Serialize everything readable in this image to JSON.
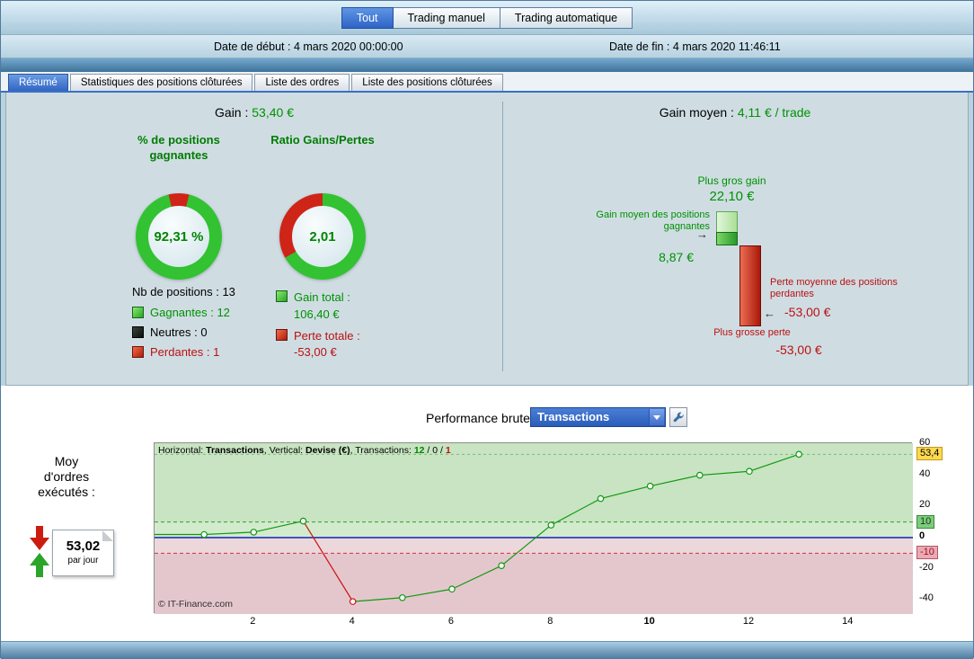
{
  "colors": {
    "accent_blue": "#3366cc",
    "positive_green": "#009100",
    "negative_red": "#bb1111",
    "chart_line_green": "#119911",
    "chart_line_red": "#cc1111",
    "zero_line_blue": "#2233bb",
    "current_value_bg": "#ffd94f"
  },
  "top_tabs": [
    {
      "label": "Tout",
      "selected": true
    },
    {
      "label": "Trading manuel",
      "selected": false
    },
    {
      "label": "Trading automatique",
      "selected": false
    }
  ],
  "date_bar": {
    "start_label": "Date de début :",
    "start_value": "4 mars 2020 00:00:00",
    "end_label": "Date de fin :",
    "end_value": "4 mars 2020 11:46:11"
  },
  "section_tabs": [
    {
      "label": "Résumé",
      "selected": true
    },
    {
      "label": "Statistiques des positions clôturées",
      "selected": false
    },
    {
      "label": "Liste des ordres",
      "selected": false
    },
    {
      "label": "Liste des positions clôturées",
      "selected": false
    }
  ],
  "summary": {
    "gain_label": "Gain : ",
    "gain_value": "53,40 €",
    "gain_moyen_label": "Gain moyen : ",
    "gain_moyen_value": "4,11 € / trade",
    "win_donut": {
      "title": "% de positions gagnantes",
      "value": "92,31 %",
      "red_pct": 7.69
    },
    "ratio_donut": {
      "title": "Ratio Gains/Pertes",
      "value": "2,01",
      "red_pct": 33.2
    },
    "nb_positions": "Nb de positions : 13",
    "legend": [
      {
        "label": "Gagnantes : 12",
        "color": "green"
      },
      {
        "label": "Neutres : 0",
        "color": "black"
      },
      {
        "label": "Perdantes : 1",
        "color": "red"
      }
    ],
    "gain_total_label": "Gain total :",
    "gain_total_value": "106,40 €",
    "perte_totale_label": "Perte totale :",
    "perte_totale_value": "-53,00 €",
    "plus_gros_gain_label": "Plus gros gain",
    "plus_gros_gain_value": "22,10 €",
    "gain_moyen_gagnantes_label": "Gain moyen des positions gagnantes",
    "gain_moyen_gagnantes_value": "8,87 €",
    "perte_moyenne_label": "Perte moyenne des positions perdantes",
    "perte_moyenne_value": "-53,00 €",
    "plus_grosse_perte_label": "Plus grosse perte",
    "plus_grosse_perte_value": "-53,00 €",
    "max_gain_eur": 22.1,
    "avg_gain_eur": 8.87,
    "max_loss_eur": 53.0
  },
  "performance": {
    "label": "Performance brute",
    "selector_value": "Transactions",
    "tool_icon": "wrench-icon",
    "avg_orders_label": "Moy d'ordres exécutés :",
    "avg_orders_value": "53,02",
    "avg_orders_unit": "par jour"
  },
  "chart_data": {
    "type": "line",
    "title": "Performance brute",
    "xlabel": "Transactions",
    "ylabel": "Devise (€)",
    "header_parts": [
      {
        "text": "Horizontal: ",
        "style": "plain"
      },
      {
        "text": "Transactions",
        "style": "bold"
      },
      {
        "text": ", Vertical: ",
        "style": "plain"
      },
      {
        "text": "Devise (€)",
        "style": "bold"
      },
      {
        "text": ", Transactions: ",
        "style": "plain"
      },
      {
        "text": "12",
        "style": "green"
      },
      {
        "text": " / ",
        "style": "plain"
      },
      {
        "text": "0",
        "style": "plain"
      },
      {
        "text": " / ",
        "style": "plain"
      },
      {
        "text": "1",
        "style": "red"
      }
    ],
    "x": [
      1,
      2,
      3,
      4,
      5,
      6,
      7,
      8,
      9,
      10,
      11,
      12,
      13
    ],
    "values": [
      2,
      3.5,
      10.6,
      -41,
      -38.5,
      -33,
      -18,
      8,
      25,
      33,
      40,
      42.5,
      53.4
    ],
    "x_ticks": [
      2,
      4,
      6,
      8,
      10,
      12,
      14
    ],
    "x_tick_bold": 10,
    "y_ticks": [
      60,
      40,
      20,
      0,
      -20,
      -40
    ],
    "x_range": [
      0,
      15.3
    ],
    "y_range": [
      -49,
      60.5
    ],
    "zero_level": 0,
    "upper_dashed_level": 10,
    "lower_dashed_level": -10,
    "current_level": 53.4,
    "current_label": "53,4",
    "upper_chip_label": "10",
    "lower_chip_label": "-10",
    "grid": false,
    "legend_position": "none",
    "copyright": "© IT-Finance.com"
  }
}
